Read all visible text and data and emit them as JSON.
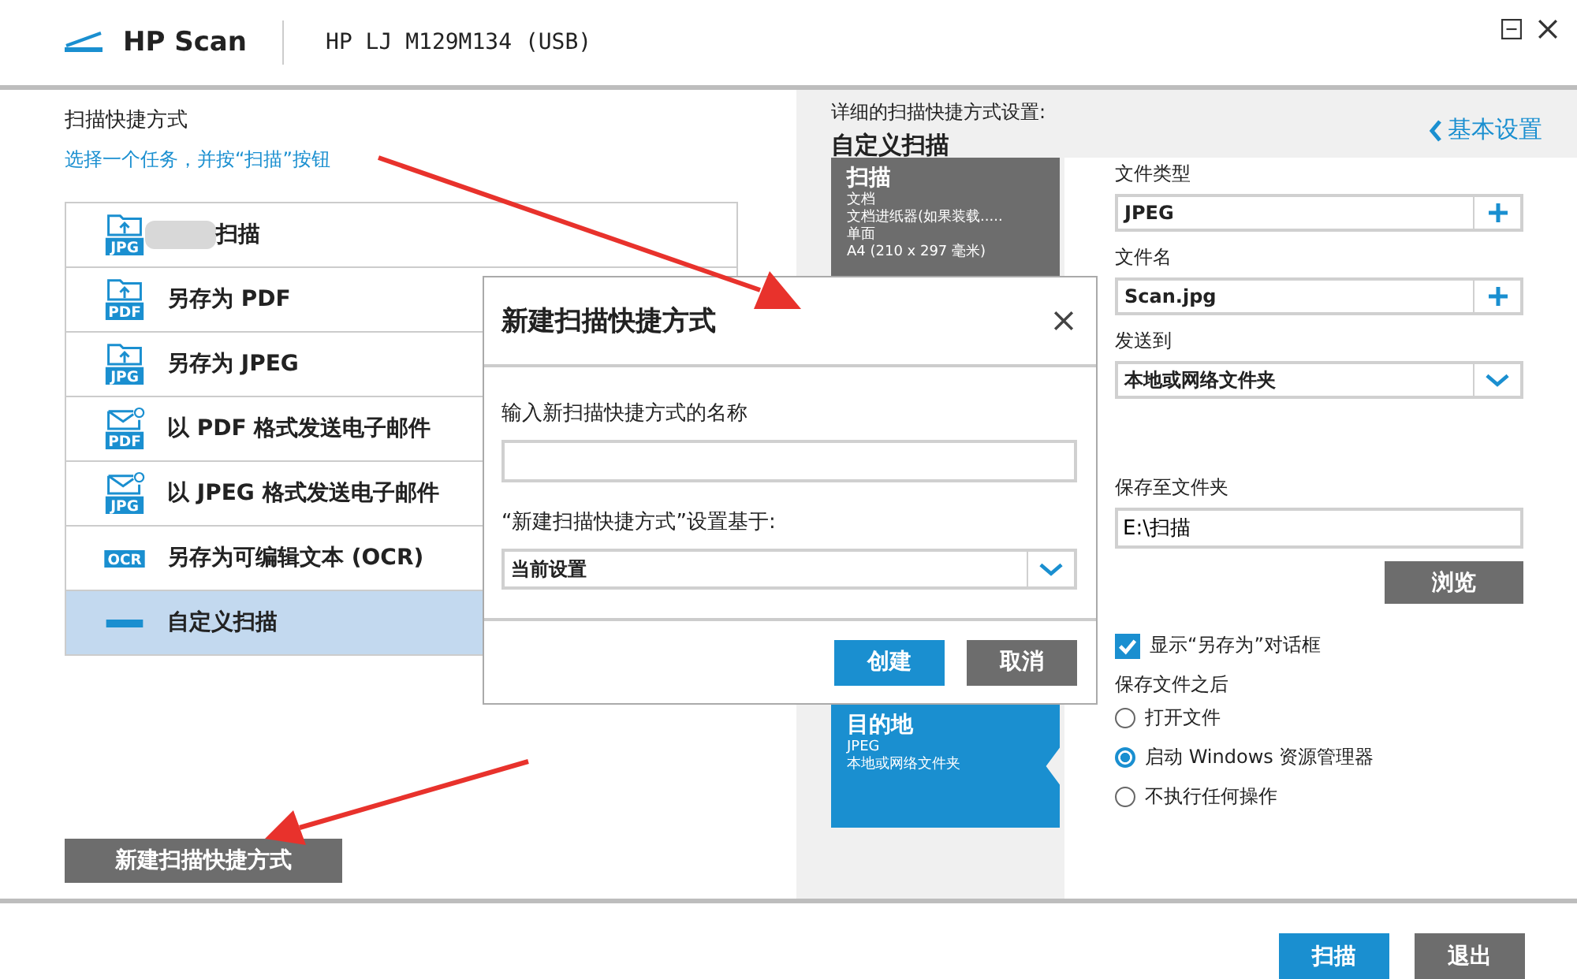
{
  "window": {
    "app_name": "HP Scan",
    "device": "HP LJ M129M134 (USB)"
  },
  "shortcuts": {
    "title": "扫描快捷方式",
    "hint": "选择一个任务，并按“扫描”按钮",
    "items": [
      {
        "kind": "folder",
        "icon_text": "JPG",
        "label": "扫描",
        "redacted": true,
        "selected": false
      },
      {
        "kind": "folder",
        "icon_text": "PDF",
        "label": "另存为 PDF",
        "redacted": false,
        "selected": false
      },
      {
        "kind": "folder",
        "icon_text": "JPG",
        "label": "另存为 JPEG",
        "redacted": false,
        "selected": false
      },
      {
        "kind": "mail",
        "icon_text": "PDF",
        "label": "以 PDF 格式发送电子邮件",
        "redacted": false,
        "selected": false
      },
      {
        "kind": "mail",
        "icon_text": "JPG",
        "label": "以 JPEG 格式发送电子邮件",
        "redacted": false,
        "selected": false
      },
      {
        "kind": "ocr",
        "icon_text": "OCR",
        "label": "另存为可编辑文本 (OCR)",
        "redacted": false,
        "selected": false
      },
      {
        "kind": "line",
        "label": "自定义扫描",
        "redacted": false,
        "selected": true
      }
    ],
    "new_button": "新建扫描快捷方式"
  },
  "details": {
    "heading": "详细的扫描快捷方式设置:",
    "title": "自定义扫描",
    "back_link": "基本设置",
    "scan_card": {
      "title": "扫描",
      "lines": [
        "文档",
        "文档进纸器(如果装载.....",
        "单面",
        "A4 (210 x 297 毫米)"
      ]
    },
    "destination_card": {
      "title": "目的地",
      "lines": [
        "JPEG",
        "本地或网络文件夹"
      ]
    },
    "file_type": {
      "label": "文件类型",
      "value": "JPEG"
    },
    "file_name": {
      "label": "文件名",
      "value": "Scan.jpg"
    },
    "send_to": {
      "label": "发送到",
      "value": "本地或网络文件夹"
    },
    "save_folder": {
      "label": "保存至文件夹",
      "value": "E:\\扫描"
    },
    "browse_button": "浏览",
    "show_save_as": {
      "label": "显示“另存为”对话框",
      "checked": true
    },
    "after_save": {
      "label": "保存文件之后",
      "options": [
        {
          "label": "打开文件",
          "selected": false
        },
        {
          "label": "启动 Windows 资源管理器",
          "selected": true
        },
        {
          "label": "不执行任何操作",
          "selected": false
        }
      ]
    }
  },
  "dialog": {
    "title": "新建扫描快捷方式",
    "name_label": "输入新扫描快捷方式的名称",
    "based_on_label": "“新建扫描快捷方式”设置基于:",
    "based_on_value": "当前设置",
    "buttons": [
      {
        "label": "创建",
        "kind": "primary"
      },
      {
        "label": "取消",
        "kind": "secondary"
      }
    ]
  },
  "footer": {
    "buttons": [
      {
        "label": "扫描",
        "kind": "primary"
      },
      {
        "label": "退出",
        "kind": "secondary"
      }
    ]
  }
}
